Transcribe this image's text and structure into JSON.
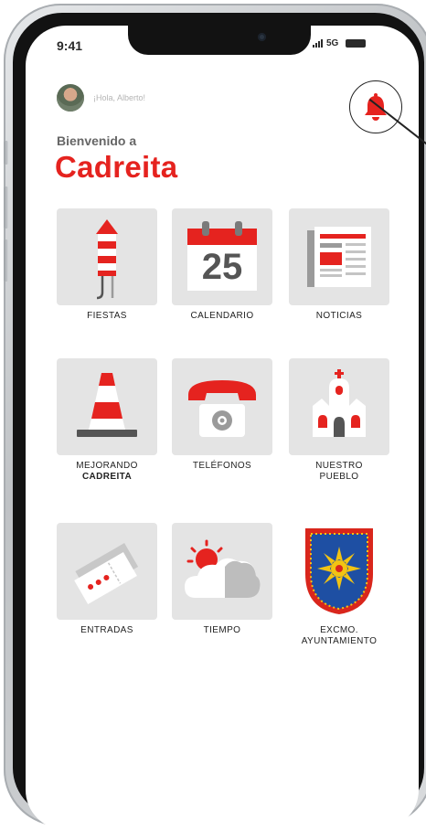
{
  "status_bar": {
    "time": "9:41",
    "network": "5G"
  },
  "header": {
    "greeting": "¡Hola, Alberto!",
    "welcome": "Bienvenido a",
    "town_name": "Cadreita"
  },
  "calendar_day": "25",
  "tiles": [
    {
      "label": "FIESTAS",
      "icon": "firework-rocket-icon"
    },
    {
      "label": "CALENDARIO",
      "icon": "calendar-icon"
    },
    {
      "label": "NOTICIAS",
      "icon": "newspaper-icon"
    },
    {
      "label": "MEJORANDO",
      "label2": "CADREITA",
      "icon": "traffic-cone-icon"
    },
    {
      "label": "TELÉFONOS",
      "icon": "telephone-icon"
    },
    {
      "label": "NUESTRO",
      "label2": "PUEBLO",
      "icon": "church-icon"
    },
    {
      "label": "ENTRADAS",
      "icon": "tickets-icon"
    },
    {
      "label": "TIEMPO",
      "icon": "weather-icon"
    },
    {
      "label": "EXCMO.",
      "label2": "AYUNTAMIENTO",
      "icon": "coat-of-arms-icon"
    }
  ],
  "colors": {
    "accent": "#e5231f",
    "tile_bg": "#e4e4e4",
    "icon_grey": "#9a9a9a"
  }
}
